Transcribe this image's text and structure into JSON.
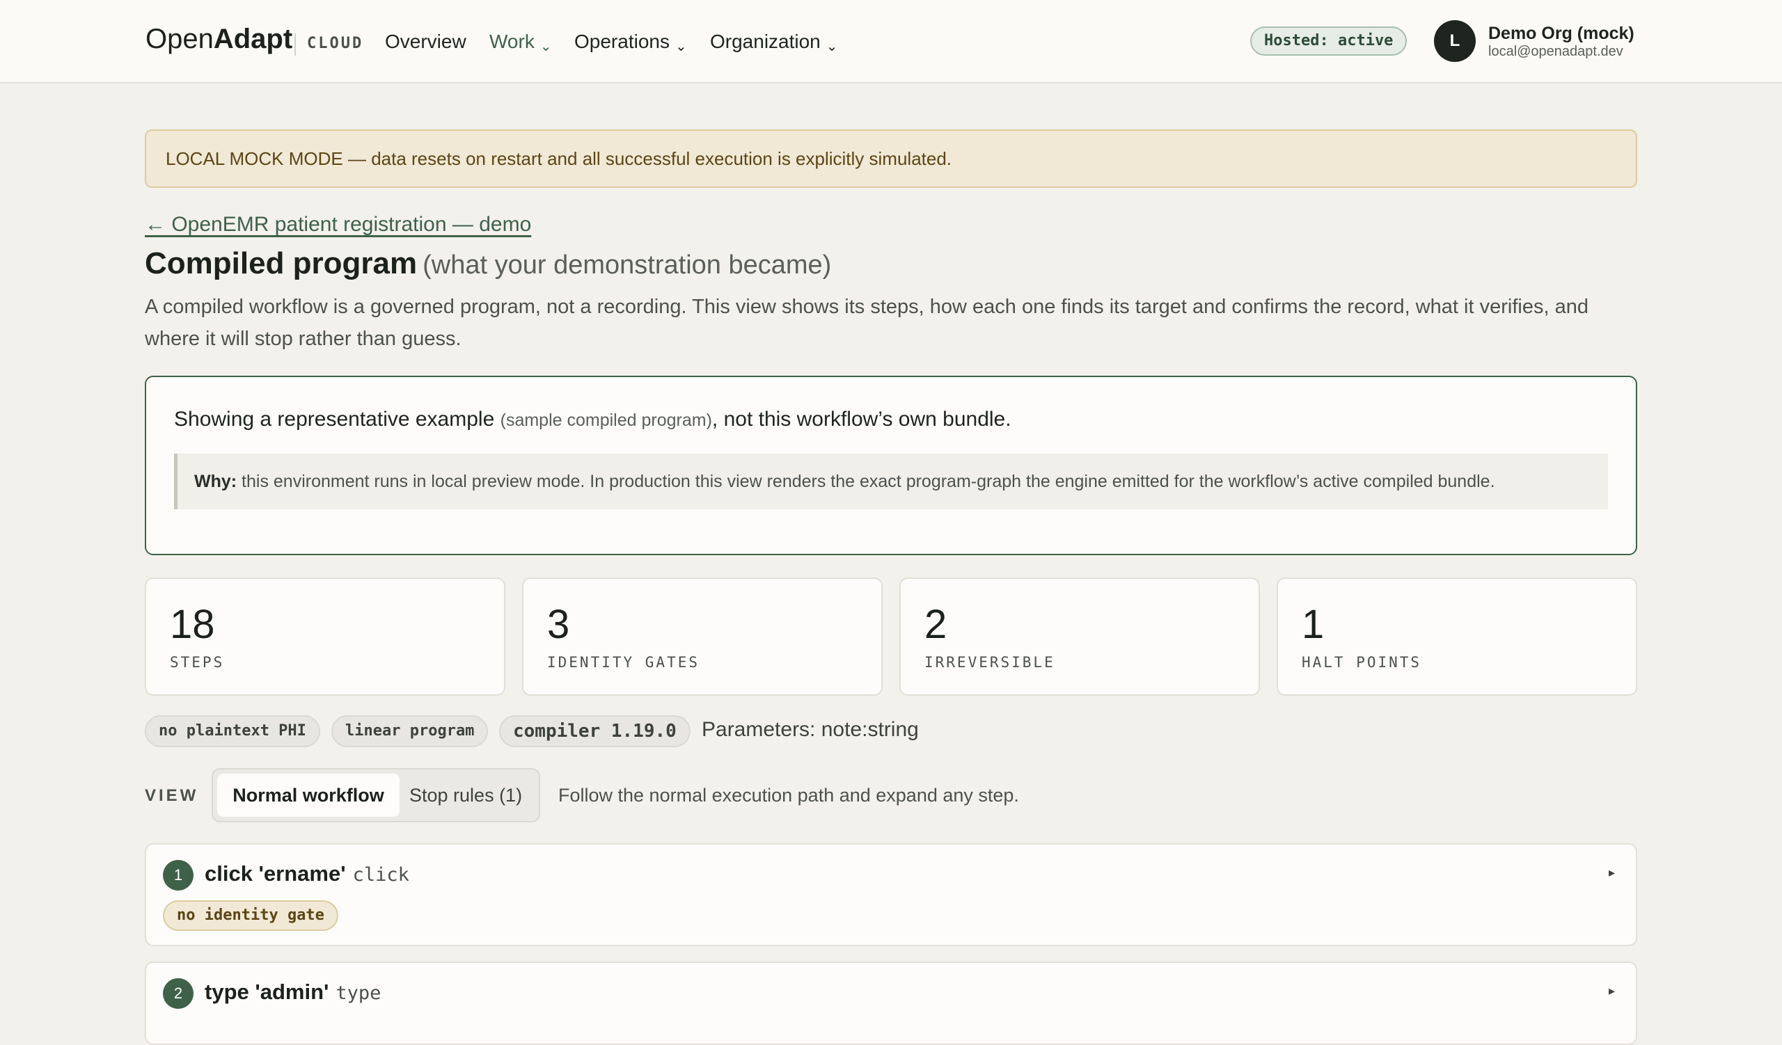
{
  "header": {
    "brand_light": "Open",
    "brand_bold": "Adapt",
    "brand_suffix": "CLOUD",
    "nav": [
      {
        "label": "Overview",
        "has_menu": false,
        "active": false
      },
      {
        "label": "Work",
        "has_menu": true,
        "active": true
      },
      {
        "label": "Operations",
        "has_menu": true,
        "active": false
      },
      {
        "label": "Organization",
        "has_menu": true,
        "active": false
      }
    ],
    "chevron": "⌄",
    "hosted_badge": "Hosted: active",
    "avatar_initial": "L",
    "org_name": "Demo Org (mock)",
    "org_email": "local@openadapt.dev"
  },
  "banner": {
    "text": "LOCAL MOCK MODE — data resets on restart and all successful execution is explicitly simulated."
  },
  "page": {
    "back_link": "← OpenEMR patient registration — demo",
    "title": "Compiled program",
    "subtitle": "(what your demonstration became)",
    "description": "A compiled workflow is a governed program, not a recording. This view shows its steps, how each one finds its target and confirms the record, what it verifies, and where it will stop rather than guess."
  },
  "example": {
    "lead": "Showing a representative example",
    "small": "(sample compiled program)",
    "tail": ", not this workflow’s own bundle.",
    "why_label": "Why:",
    "why_text": " this environment runs in local preview mode. In production this view renders the exact program-graph the engine emitted for the workflow’s active compiled bundle."
  },
  "stats": [
    {
      "value": "18",
      "label": "STEPS"
    },
    {
      "value": "3",
      "label": "IDENTITY GATES"
    },
    {
      "value": "2",
      "label": "IRREVERSIBLE"
    },
    {
      "value": "1",
      "label": "HALT POINTS"
    }
  ],
  "chips": [
    "no plaintext PHI",
    "linear program",
    "compiler 1.19.0"
  ],
  "parameters": "Parameters: note:string",
  "view": {
    "label": "VIEW",
    "options": [
      "Normal workflow",
      "Stop rules (1)"
    ],
    "selected": "Normal workflow",
    "hint": "Follow the normal execution path and expand any step."
  },
  "steps": [
    {
      "num": "1",
      "title": "click 'ername'",
      "kind": "click",
      "gate": "no identity gate",
      "toggle": "▸"
    },
    {
      "num": "2",
      "title": "type 'admin'",
      "kind": "type",
      "toggle": "▸"
    }
  ],
  "colors": {
    "accent": "#3f6149",
    "background": "#f3f1ec",
    "banner_bg": "#f1e8d6",
    "warning_text": "#5b4615"
  },
  "icons": {
    "avatar": "avatar",
    "chevron": "chevron-down-icon",
    "step_toggle": "caret-right-icon"
  }
}
